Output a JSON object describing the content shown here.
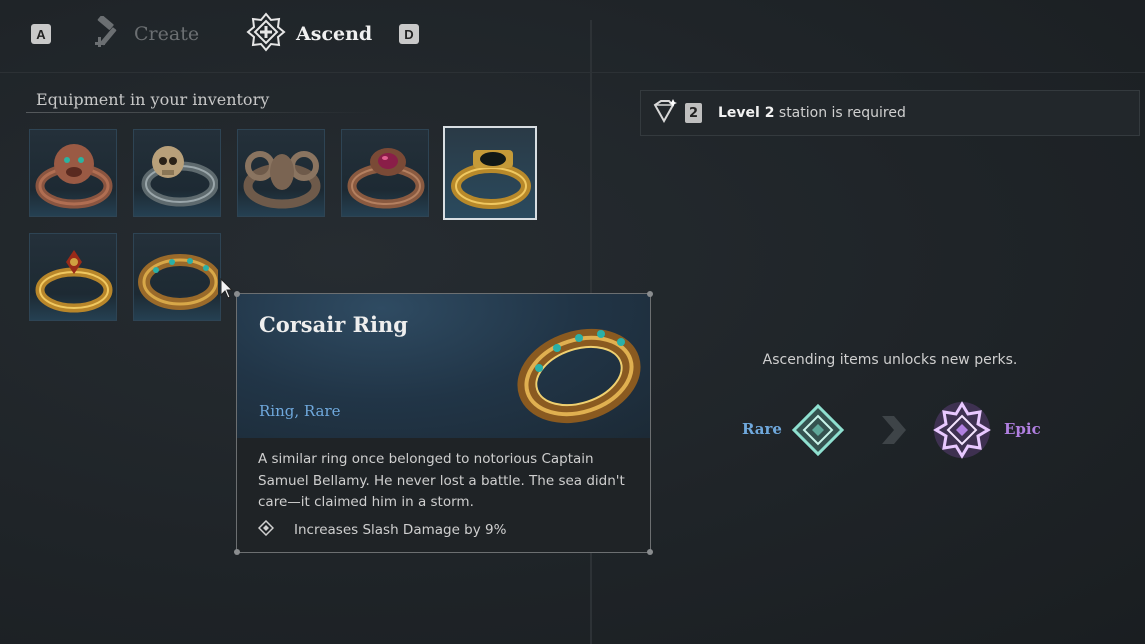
{
  "header": {
    "key_left": "A",
    "key_right": "D",
    "tabs": [
      {
        "label": "Create",
        "icon": "hammer-icon",
        "active": false
      },
      {
        "label": "Ascend",
        "icon": "ascend-icon",
        "active": true
      }
    ]
  },
  "inventory": {
    "title": "Equipment in your inventory",
    "items": [
      {
        "name": "lion-ring",
        "selected": false
      },
      {
        "name": "skull-ring",
        "selected": false
      },
      {
        "name": "ram-ring",
        "selected": false
      },
      {
        "name": "ruby-signet-ring",
        "selected": false
      },
      {
        "name": "onyx-gold-ring",
        "selected": true
      },
      {
        "name": "fleur-gold-ring",
        "selected": false
      },
      {
        "name": "corsair-ring",
        "selected": false,
        "hovered": true
      }
    ]
  },
  "requirement": {
    "level": "2",
    "text_bold": "Level 2",
    "text_rest": " station is required"
  },
  "tooltip": {
    "title": "Corsair Ring",
    "subtitle": "Ring, Rare",
    "description": "A similar ring once belonged to notorious Captain Samuel Bellamy. He never lost a battle. The sea didn't care—it claimed him in a storm.",
    "perk": "Increases Slash Damage by 9%"
  },
  "ascension": {
    "info": "Ascending items unlocks new perks.",
    "from": "Rare",
    "to": "Epic",
    "from_color": "#6fa8dc",
    "to_color": "#b07fe0"
  }
}
